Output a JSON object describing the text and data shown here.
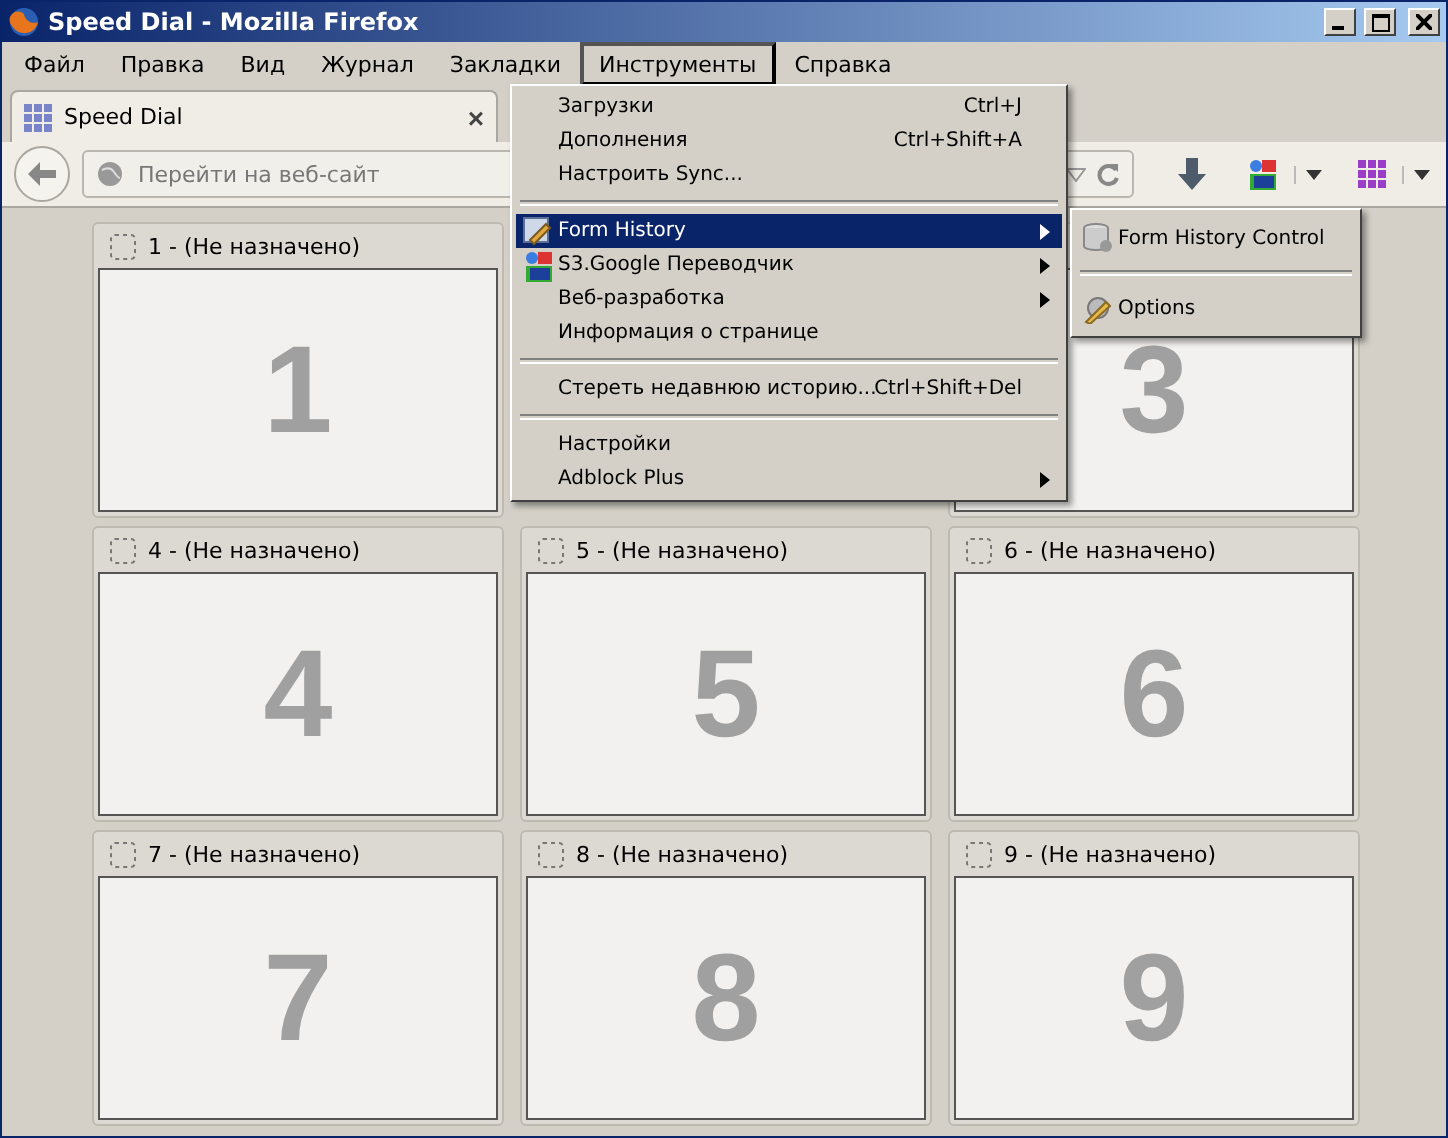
{
  "window": {
    "title": "Speed Dial - Mozilla Firefox"
  },
  "menubar": [
    {
      "label": "Файл",
      "selected": false
    },
    {
      "label": "Правка",
      "selected": false
    },
    {
      "label": "Вид",
      "selected": false
    },
    {
      "label": "Журнал",
      "selected": false
    },
    {
      "label": "Закладки",
      "selected": false
    },
    {
      "label": "Инструменты",
      "selected": true
    },
    {
      "label": "Справка",
      "selected": false
    }
  ],
  "tab": {
    "label": "Speed Dial",
    "close": "×"
  },
  "address": {
    "placeholder": "Перейти на веб-сайт"
  },
  "tiles": [
    {
      "kind": "tile",
      "label": "1 - (Не назначено)",
      "number": "1"
    },
    {
      "kind": "covered"
    },
    {
      "kind": "tile",
      "number": "3"
    },
    {
      "kind": "tile",
      "label": "4 - (Не назначено)",
      "number": "4"
    },
    {
      "kind": "tile",
      "label": "5 - (Не назначено)",
      "number": "5"
    },
    {
      "kind": "tile",
      "label": "6 - (Не назначено)",
      "number": "6"
    },
    {
      "kind": "tile",
      "label": "7 - (Не назначено)",
      "number": "7"
    },
    {
      "kind": "tile",
      "label": "8 - (Не назначено)",
      "number": "8"
    },
    {
      "kind": "tile",
      "label": "9 - (Не назначено)",
      "number": "9"
    }
  ],
  "menu": [
    {
      "kind": "item",
      "label": "Загрузки",
      "shortcut": "Ctrl+J",
      "submenu": false,
      "selected": false
    },
    {
      "kind": "item",
      "label": "Дополнения",
      "shortcut": "Ctrl+Shift+A",
      "submenu": false,
      "selected": false
    },
    {
      "kind": "item",
      "label": "Настроить Sync...",
      "submenu": false,
      "selected": false
    },
    {
      "kind": "separator"
    },
    {
      "kind": "item",
      "label": "Form History",
      "submenu": true,
      "selected": true
    },
    {
      "kind": "item",
      "label": "S3.Google Переводчик",
      "submenu": true,
      "selected": false
    },
    {
      "kind": "item",
      "label": "Веб-разработка",
      "submenu": true,
      "selected": false
    },
    {
      "kind": "item",
      "label": "Информация о странице",
      "submenu": false,
      "selected": false
    },
    {
      "kind": "separator"
    },
    {
      "kind": "item",
      "label": "Стереть недавнюю историю...",
      "shortcut": "Ctrl+Shift+Del",
      "submenu": false,
      "selected": false
    },
    {
      "kind": "separator"
    },
    {
      "kind": "item",
      "label": "Настройки",
      "submenu": false,
      "selected": false
    },
    {
      "kind": "item",
      "label": "Adblock Plus",
      "submenu": true,
      "selected": false
    }
  ],
  "submenu": [
    {
      "kind": "item",
      "label": "Form History Control",
      "selected": false
    },
    {
      "kind": "separator"
    },
    {
      "kind": "item",
      "label": "Options",
      "selected": false
    }
  ]
}
